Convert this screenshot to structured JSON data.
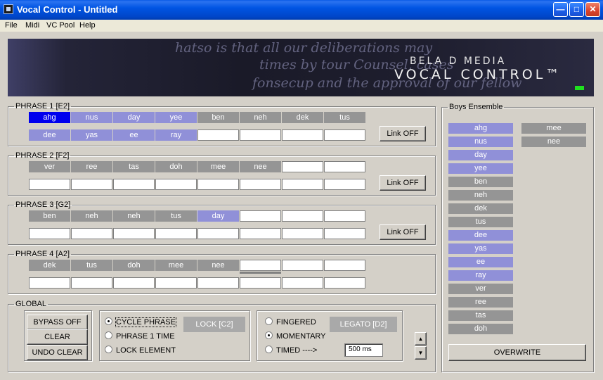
{
  "window": {
    "title": "Vocal Control - Untitled"
  },
  "menu": [
    "File",
    "Midi",
    "VC Pool",
    "Help"
  ],
  "banner": {
    "brand_line1": "BELA D MEDIA",
    "brand_line2": "VOCAL CONTROL™",
    "script_lines": [
      "hatso is that all our deliberations may",
      "times by tour Counsel, cases",
      "fonsecup and the approval of our fellow"
    ]
  },
  "phrases": [
    {
      "label": "PHRASE 1  [E2]",
      "link_label": "Link OFF",
      "row1": [
        {
          "t": "ahg",
          "c": "blue"
        },
        {
          "t": "nus",
          "c": "lav"
        },
        {
          "t": "day",
          "c": "lav"
        },
        {
          "t": "yee",
          "c": "lav"
        },
        {
          "t": "ben",
          "c": "gray"
        },
        {
          "t": "neh",
          "c": "gray"
        },
        {
          "t": "dek",
          "c": "gray"
        },
        {
          "t": "tus",
          "c": "gray"
        }
      ],
      "row2": [
        {
          "t": "dee",
          "c": "lav"
        },
        {
          "t": "yas",
          "c": "lav"
        },
        {
          "t": "ee",
          "c": "lav"
        },
        {
          "t": "ray",
          "c": "lav"
        },
        {
          "t": "",
          "c": "empty"
        },
        {
          "t": "",
          "c": "empty"
        },
        {
          "t": "",
          "c": "empty"
        },
        {
          "t": "",
          "c": "empty"
        }
      ]
    },
    {
      "label": "PHRASE 2  [F2]",
      "link_label": "Link OFF",
      "row1": [
        {
          "t": "ver",
          "c": "gray"
        },
        {
          "t": "ree",
          "c": "gray"
        },
        {
          "t": "tas",
          "c": "gray"
        },
        {
          "t": "doh",
          "c": "gray"
        },
        {
          "t": "mee",
          "c": "gray"
        },
        {
          "t": "nee",
          "c": "gray"
        },
        {
          "t": "",
          "c": "empty"
        },
        {
          "t": "",
          "c": "empty"
        }
      ],
      "row2": [
        {
          "t": "",
          "c": "empty"
        },
        {
          "t": "",
          "c": "empty"
        },
        {
          "t": "",
          "c": "empty"
        },
        {
          "t": "",
          "c": "empty"
        },
        {
          "t": "",
          "c": "empty"
        },
        {
          "t": "",
          "c": "empty"
        },
        {
          "t": "",
          "c": "empty"
        },
        {
          "t": "",
          "c": "empty"
        }
      ]
    },
    {
      "label": "PHRASE 3  [G2]",
      "link_label": "Link OFF",
      "row1": [
        {
          "t": "ben",
          "c": "gray"
        },
        {
          "t": "neh",
          "c": "gray"
        },
        {
          "t": "neh",
          "c": "gray"
        },
        {
          "t": "tus",
          "c": "gray"
        },
        {
          "t": "day",
          "c": "lav"
        },
        {
          "t": "",
          "c": "empty"
        },
        {
          "t": "",
          "c": "empty"
        },
        {
          "t": "",
          "c": "empty"
        }
      ],
      "row2": [
        {
          "t": "",
          "c": "empty"
        },
        {
          "t": "",
          "c": "empty"
        },
        {
          "t": "",
          "c": "empty"
        },
        {
          "t": "",
          "c": "empty"
        },
        {
          "t": "",
          "c": "empty"
        },
        {
          "t": "",
          "c": "empty"
        },
        {
          "t": "",
          "c": "empty"
        },
        {
          "t": "",
          "c": "empty"
        }
      ]
    },
    {
      "label": "PHRASE 4  [A2]",
      "link_label": "",
      "row1": [
        {
          "t": "dek",
          "c": "gray"
        },
        {
          "t": "tus",
          "c": "gray"
        },
        {
          "t": "doh",
          "c": "gray"
        },
        {
          "t": "mee",
          "c": "gray"
        },
        {
          "t": "nee",
          "c": "gray"
        },
        {
          "t": "",
          "c": "empty"
        },
        {
          "t": "",
          "c": "empty"
        },
        {
          "t": "",
          "c": "empty"
        }
      ],
      "row2": [
        {
          "t": "",
          "c": "empty"
        },
        {
          "t": "",
          "c": "empty"
        },
        {
          "t": "",
          "c": "empty"
        },
        {
          "t": "",
          "c": "empty"
        },
        {
          "t": "",
          "c": "empty"
        },
        {
          "t": "",
          "c": "empty"
        },
        {
          "t": "",
          "c": "empty"
        },
        {
          "t": "",
          "c": "empty"
        }
      ]
    }
  ],
  "global": {
    "label": "GLOBAL",
    "bypass": "BYPASS OFF",
    "clear": "CLEAR",
    "undo_clear": "UNDO CLEAR",
    "cycle_phrase": "CYCLE PHRASE",
    "phrase_1_time": "PHRASE 1 TIME",
    "lock_element": "LOCK ELEMENT",
    "lock_button": "LOCK [C2]",
    "fingered": "FINGERED",
    "momentary": "MOMENTARY",
    "timed": "TIMED ---->",
    "legato_button": "LEGATO [D2]",
    "time_value": "500 ms",
    "spin_up": "▲",
    "spin_down": "▼"
  },
  "ensemble": {
    "label": "Boys Ensemble",
    "col1": [
      {
        "t": "ahg",
        "c": "lav"
      },
      {
        "t": "nus",
        "c": "lav"
      },
      {
        "t": "day",
        "c": "lav"
      },
      {
        "t": "yee",
        "c": "lav"
      },
      {
        "t": "ben",
        "c": "gray"
      },
      {
        "t": "neh",
        "c": "gray"
      },
      {
        "t": "dek",
        "c": "gray"
      },
      {
        "t": "tus",
        "c": "gray"
      },
      {
        "t": "dee",
        "c": "lav"
      },
      {
        "t": "yas",
        "c": "lav"
      },
      {
        "t": "ee",
        "c": "lav"
      },
      {
        "t": "ray",
        "c": "lav"
      },
      {
        "t": "ver",
        "c": "gray"
      },
      {
        "t": "ree",
        "c": "gray"
      },
      {
        "t": "tas",
        "c": "gray"
      },
      {
        "t": "doh",
        "c": "gray"
      }
    ],
    "col2": [
      {
        "t": "mee",
        "c": "gray"
      },
      {
        "t": "nee",
        "c": "gray"
      }
    ],
    "overwrite": "OVERWRITE"
  }
}
